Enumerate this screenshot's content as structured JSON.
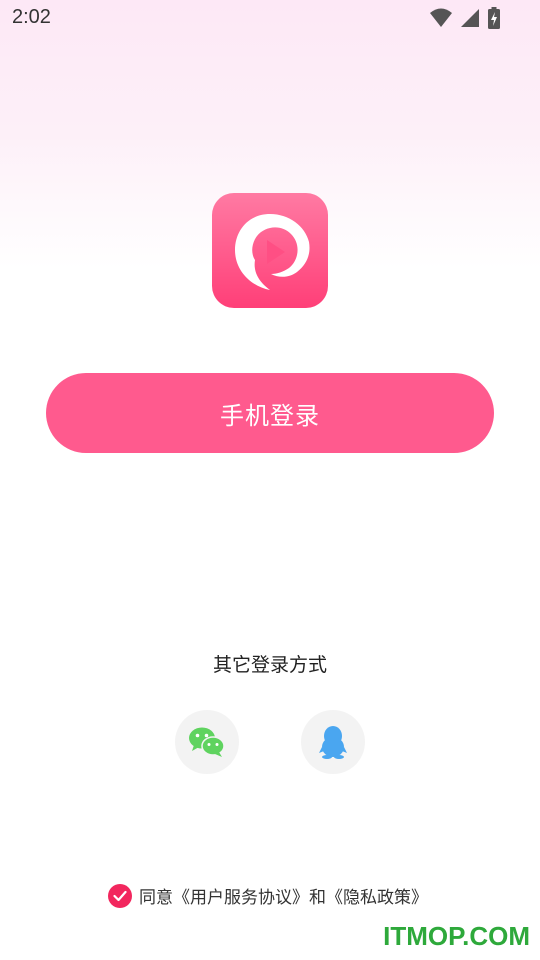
{
  "status_bar": {
    "time": "2:02",
    "icons": [
      "wifi-icon",
      "signal-icon",
      "battery-charging-icon"
    ]
  },
  "app": {
    "logo_icon": "play-p-logo",
    "brand_color": "#ff5a8e"
  },
  "login": {
    "phone_login_label": "手机登录"
  },
  "other_login": {
    "title": "其它登录方式",
    "options": [
      {
        "name": "wechat",
        "icon": "wechat-icon",
        "color": "#5fd35f"
      },
      {
        "name": "qq",
        "icon": "qq-penguin-icon",
        "color": "#4aa6f0"
      }
    ]
  },
  "agreement": {
    "checked": true,
    "prefix": "同意",
    "user_agreement": "《用户服务协议》",
    "conjunction": "和",
    "privacy_policy": "《隐私政策》"
  },
  "watermark": "ITMOP.COM"
}
